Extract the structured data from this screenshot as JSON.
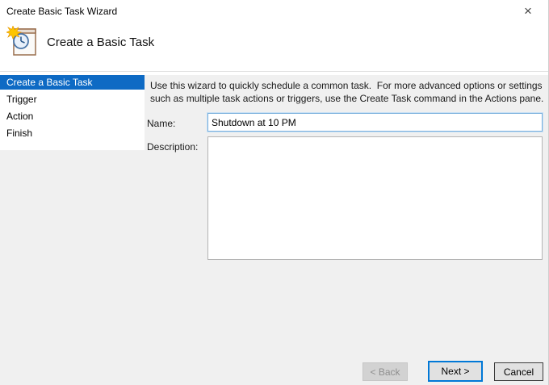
{
  "window": {
    "title": "Create Basic Task Wizard"
  },
  "icons": {
    "close": "×",
    "header": "task-scheduler-wizard-icon"
  },
  "header": {
    "title": "Create a Basic Task"
  },
  "sidebar": {
    "items": [
      {
        "label": "Create a Basic Task",
        "selected": true
      },
      {
        "label": "Trigger",
        "selected": false
      },
      {
        "label": "Action",
        "selected": false
      },
      {
        "label": "Finish",
        "selected": false
      }
    ]
  },
  "main": {
    "instructions_line1": "Use this wizard to quickly schedule a common task.  For more advanced options or settings",
    "instructions_line2": "such as multiple task actions or triggers, use the Create Task command in the Actions pane.",
    "fields": {
      "name": {
        "label": "Name:",
        "value": "Shutdown at 10 PM"
      },
      "description": {
        "label": "Description:",
        "value": ""
      }
    }
  },
  "footer": {
    "back_label": "< Back",
    "next_label": "Next >",
    "cancel_label": "Cancel"
  },
  "colors": {
    "selection_blue": "#0e6ac4",
    "default_button_border": "#0078d7",
    "input_focus_border": "#7ab0dd",
    "panel_gray": "#f0f0f0"
  }
}
